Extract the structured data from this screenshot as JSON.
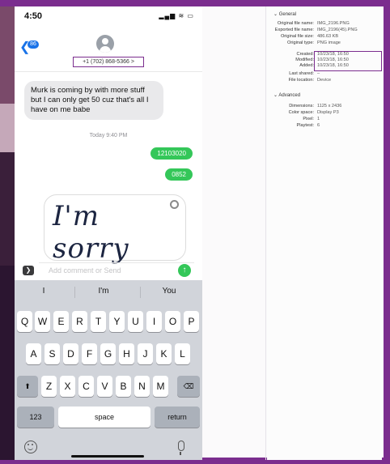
{
  "phone": {
    "status_time": "4:50",
    "status_icons": "▂▄▆ ≋ ▭",
    "back_badge": "86",
    "phone_number": "+1 (702) 868-5366 >",
    "incoming_message": "Murk is coming by with more stuff but I can only get 50 cuz that's all I have on me babe",
    "timestamp": "Today 9:40 PM",
    "outgoing": [
      "12103020",
      "0852"
    ],
    "handwriting": "I'm sorry",
    "comment_placeholder": "Add comment or Send",
    "keyboard": {
      "predictions": [
        "I",
        "I'm",
        "You"
      ],
      "row1": [
        "Q",
        "W",
        "E",
        "R",
        "T",
        "Y",
        "U",
        "I",
        "O",
        "P"
      ],
      "row2": [
        "A",
        "S",
        "D",
        "F",
        "G",
        "H",
        "J",
        "K",
        "L"
      ],
      "row3": [
        "Z",
        "X",
        "C",
        "V",
        "B",
        "N",
        "M"
      ],
      "numbers_key": "123",
      "space_key": "space",
      "return_key": "return",
      "shift_icon": "shift-icon",
      "delete_icon": "delete-icon"
    }
  },
  "info_panel": {
    "general_heading": "General",
    "general_rows": [
      {
        "key": "Original file name:",
        "value": "IMG_2196.PNG"
      },
      {
        "key": "Exported file name:",
        "value": "IMG_2196(45).PNG"
      },
      {
        "key": "Original file size:",
        "value": "486.63 KB"
      },
      {
        "key": "Original type:",
        "value": "PNG image"
      },
      {
        "key": "Created:",
        "value": "10/23/18, 16:50"
      },
      {
        "key": "Modified:",
        "value": "10/23/18, 16:50"
      },
      {
        "key": "Added:",
        "value": "10/23/18, 16:50"
      },
      {
        "key": "Last shared:",
        "value": "–"
      },
      {
        "key": "File location:",
        "value": "Device"
      }
    ],
    "advanced_heading": "Advanced",
    "advanced_rows": [
      {
        "key": "Dimensions:",
        "value": "1125 x 2436"
      },
      {
        "key": "Color space:",
        "value": "Display P3"
      },
      {
        "key": "Pixel:",
        "value": "1"
      },
      {
        "key": "Playtest:",
        "value": "6"
      }
    ]
  },
  "colors": {
    "frame": "#7b2d8e",
    "imessage_green": "#34c759",
    "imessage_blue": "#1a73e8"
  }
}
